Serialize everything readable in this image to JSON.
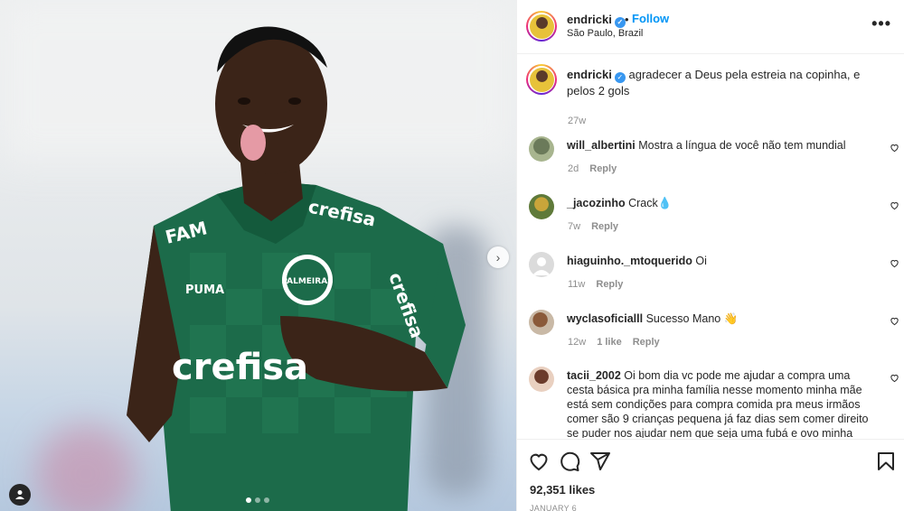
{
  "post": {
    "username": "endricki",
    "follow_label": "Follow",
    "location": "São Paulo, Brazil",
    "more_label": "•••",
    "next_label": "›",
    "caption": {
      "username": "endricki",
      "text": "agradecer a Deus pela estreia na copinha, e pelos 2 gols",
      "time": "27w"
    },
    "photo_jersey_text": {
      "sponsor_chest": "crefisa",
      "sponsor_collar": "crefisa",
      "sponsor_sleeve": "crefisa",
      "shoulder": "FAM",
      "brand": "PUMA",
      "crest": "PALMEIRAS"
    },
    "slide_count": 3,
    "active_slide": 0
  },
  "comments": [
    {
      "username": "will_albertini",
      "text": "Mostra a língua de você não tem mundial",
      "time": "2d",
      "reply_label": "Reply",
      "likes": ""
    },
    {
      "username": "_jacozinho",
      "text": "Crack💧",
      "time": "7w",
      "reply_label": "Reply",
      "likes": ""
    },
    {
      "username": "hiaguinho._mtoquerido",
      "text": "Oi",
      "time": "11w",
      "reply_label": "Reply",
      "likes": ""
    },
    {
      "username": "wyclasoficialll",
      "text": "Sucesso Mano 👋",
      "time": "12w",
      "reply_label": "Reply",
      "likes": "1 like"
    },
    {
      "username": "tacii_2002",
      "text": "Oi bom dia vc pode me ajudar a compra uma cesta básica pra minha família nesse momento minha mãe está sem condições para compra comida pra meus irmãos comer são 9 crianças pequena já faz dias sem comer direito se puder nos ajudar nem que seja uma fubá e ovo minha mãe está",
      "time": "",
      "reply_label": "",
      "likes": ""
    }
  ],
  "footer": {
    "likes": "92,351 likes",
    "date": "JANUARY 6"
  },
  "colors": {
    "link_blue": "#0095f6",
    "verified_blue": "#3897f0",
    "muted_text": "#8e8e8e",
    "jersey_green": "#1c6b4a"
  },
  "icons": [
    "verified-icon",
    "more-icon",
    "heart-icon",
    "comment-icon",
    "share-icon",
    "bookmark-icon",
    "user-tag-icon",
    "chevron-right-icon"
  ]
}
